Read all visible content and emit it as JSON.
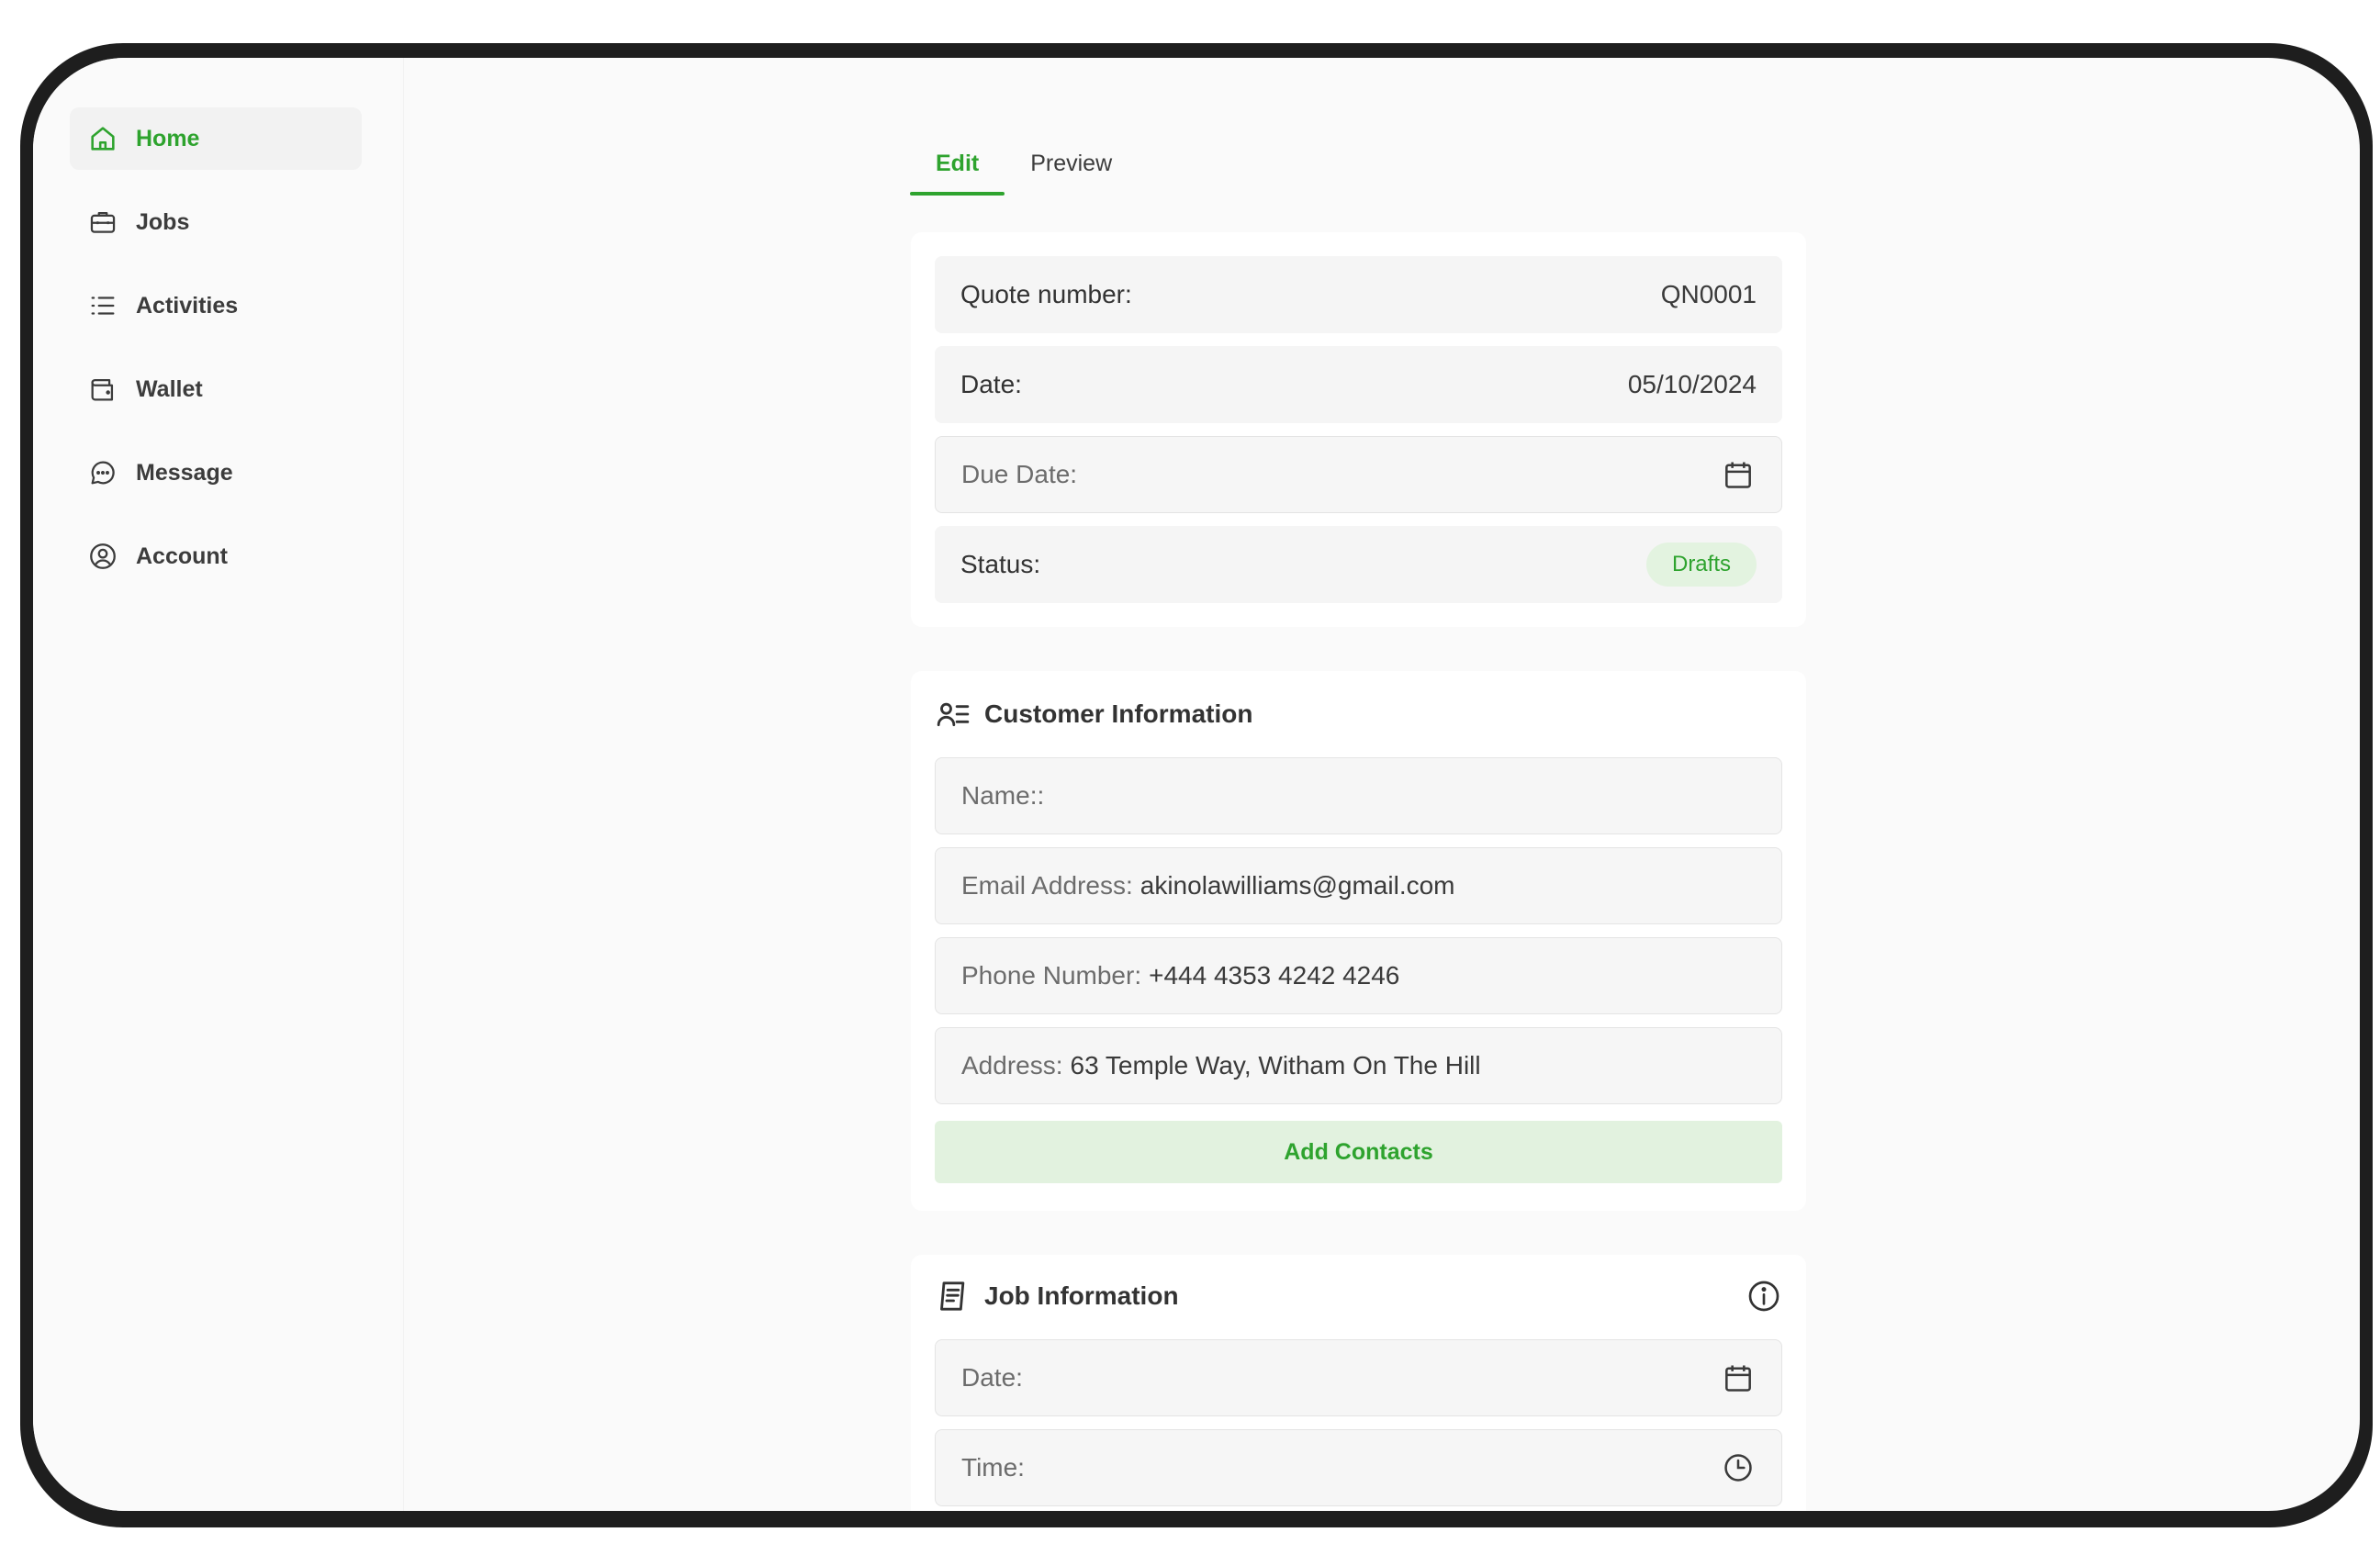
{
  "sidebar": {
    "items": [
      {
        "label": "Home",
        "icon": "home-icon",
        "active": true
      },
      {
        "label": "Jobs",
        "icon": "briefcase-icon"
      },
      {
        "label": "Activities",
        "icon": "list-icon"
      },
      {
        "label": "Wallet",
        "icon": "wallet-icon"
      },
      {
        "label": "Message",
        "icon": "chat-icon"
      },
      {
        "label": "Account",
        "icon": "user-circle-icon"
      }
    ]
  },
  "tabs": [
    {
      "label": "Edit",
      "active": true
    },
    {
      "label": "Preview"
    }
  ],
  "quote": {
    "quote_number_label": "Quote number:",
    "quote_number_value": "QN0001",
    "date_label": "Date:",
    "date_value": "05/10/2024",
    "due_date_label": "Due Date:",
    "status_label": "Status:",
    "status_value": "Drafts"
  },
  "customer": {
    "title": "Customer Information",
    "name_label": "Name::",
    "email_label": "Email Address:",
    "email_value": "akinolawilliams@gmail.com",
    "phone_label": "Phone Number:",
    "phone_value": "+444 4353 4242 4246",
    "address_label": "Address:",
    "address_value": "63 Temple Way, Witham On The Hill",
    "add_contacts_label": "Add Contacts"
  },
  "job": {
    "title": "Job Information",
    "date_label": "Date:",
    "time_label": "Time:"
  },
  "colors": {
    "accent": "#2ea32e",
    "accent_light": "#e2f2df",
    "device_frame": "#1e1e1e"
  }
}
